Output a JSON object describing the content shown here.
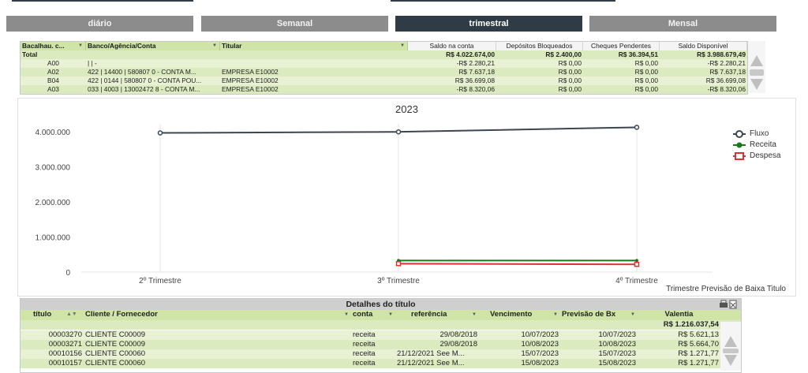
{
  "tabs": [
    {
      "label": "diário",
      "active": false
    },
    {
      "label": "Semanal",
      "active": false
    },
    {
      "label": "trimestral",
      "active": true
    },
    {
      "label": "Mensal",
      "active": false
    }
  ],
  "summary_table": {
    "headers": [
      "Bacalhau. c...",
      "Banco/Agência/Conta",
      "Titular",
      "Saldo na conta",
      "Depósitos Bloqueados",
      "Cheques Pendentes",
      "Saldo Disponível"
    ],
    "total": {
      "label": "Total",
      "saldo": "R$ 4.022.674,00",
      "depositos": "R$ 2.400,00",
      "cheques": "R$ 36.394,51",
      "disponivel": "R$ 3.988.679,49"
    },
    "rows": [
      {
        "code": "A00",
        "banco": "| | -",
        "titular": "",
        "saldo": "-R$ 2.280,21",
        "depositos": "R$ 0,00",
        "cheques": "R$ 0,00",
        "disponivel": "-R$ 2.280,21"
      },
      {
        "code": "A02",
        "banco": "422 | 14400 | 580807 0 - CONTA M...",
        "titular": "EMPRESA E10002",
        "saldo": "R$ 7.637,18",
        "depositos": "R$ 0,00",
        "cheques": "R$ 0,00",
        "disponivel": "R$ 7.637,18"
      },
      {
        "code": "B04",
        "banco": "422 | 0144 | 580807 0 - CONTA POU...",
        "titular": "EMPRESA E10002",
        "saldo": "R$ 36.699,08",
        "depositos": "R$ 0,00",
        "cheques": "R$ 0,00",
        "disponivel": "R$ 36.699,08"
      },
      {
        "code": "A03",
        "banco": "033 | 4003 | 13002472 8 - CONTA M...",
        "titular": "EMPRESA E10002",
        "saldo": "-R$ 8.320,06",
        "depositos": "R$ 0,00",
        "cheques": "R$ 0,00",
        "disponivel": "-R$ 8.320,06"
      }
    ]
  },
  "chart_data": {
    "type": "line",
    "title": "2023",
    "categories": [
      "2º Trimestre",
      "3º Trimestre",
      "4º Trimestre"
    ],
    "xlabel": "Trimestre Previsão de Baixa Titulo",
    "ylim": [
      0,
      4500000
    ],
    "yticks": [
      "0",
      "1.000.000",
      "2.000.000",
      "3.000.000",
      "4.000.000"
    ],
    "ytick_values": [
      0,
      1000000,
      2000000,
      3000000,
      4000000
    ],
    "series": [
      {
        "name": "Fluxo",
        "color": "#3c4650",
        "values": [
          3970000,
          4000000,
          4130000
        ]
      },
      {
        "name": "Receita",
        "color": "#1a7a1a",
        "values": [
          null,
          330000,
          330000
        ]
      },
      {
        "name": "Despesa",
        "color": "#e03030",
        "values": [
          null,
          240000,
          220000
        ]
      }
    ],
    "legend_position": "top-right",
    "grid": "vertical"
  },
  "details_table": {
    "title": "Detalhes do título",
    "headers": [
      "título",
      "Cliente / Fornecedor",
      "conta",
      "referência",
      "Vencimento",
      "Previsão de Bx",
      "Valentia"
    ],
    "total": "R$ 1.216.037,54",
    "rows": [
      {
        "titulo": "00003270",
        "cliente": "CLIENTE C00009",
        "conta": "receita",
        "ref": "29/08/2018",
        "venc": "10/07/2023",
        "prev": "10/07/2023",
        "valor": "R$ 5.621,13"
      },
      {
        "titulo": "00003271",
        "cliente": "CLIENTE C00009",
        "conta": "receita",
        "ref": "29/08/2018",
        "venc": "10/08/2023",
        "prev": "10/08/2023",
        "valor": "R$ 5.664,70"
      },
      {
        "titulo": "00010156",
        "cliente": "CLIENTE C00060",
        "conta": "receita",
        "ref": "21/12/2021 See M...",
        "venc": "15/07/2023",
        "prev": "15/07/2023",
        "valor": "R$ 1.271,77"
      },
      {
        "titulo": "00010157",
        "cliente": "CLIENTE C00060",
        "conta": "receita",
        "ref": "21/12/2021 See M...",
        "venc": "15/08/2023",
        "prev": "15/08/2023",
        "valor": "R$ 1.271,77"
      }
    ]
  }
}
